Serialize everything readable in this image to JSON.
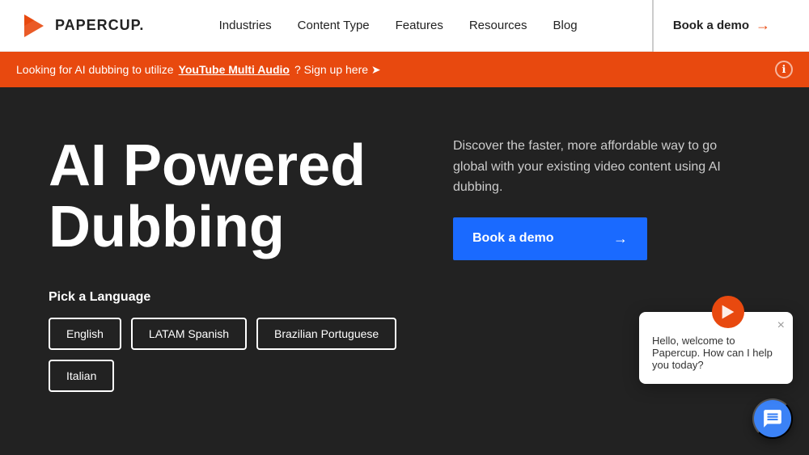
{
  "nav": {
    "logo_text": "PAPERCUP.",
    "links": [
      {
        "label": "Industries",
        "id": "industries"
      },
      {
        "label": "Content Type",
        "id": "content-type"
      },
      {
        "label": "Features",
        "id": "features"
      },
      {
        "label": "Resources",
        "id": "resources"
      },
      {
        "label": "Blog",
        "id": "blog"
      }
    ],
    "cta_label": "Book a demo"
  },
  "banner": {
    "prefix": "Looking for AI dubbing to utilize",
    "link": "YouTube Multi Audio",
    "suffix": "? Sign up here ➤",
    "info_icon": "ℹ"
  },
  "hero": {
    "title_line1": "AI Powered",
    "title_line2": "Dubbing",
    "description": "Discover the faster, more affordable way to go global with your existing video content using AI dubbing.",
    "cta_label": "Book a demo",
    "lang_label": "Pick a Language",
    "languages": [
      {
        "label": "English",
        "id": "english"
      },
      {
        "label": "LATAM Spanish",
        "id": "latam-spanish"
      },
      {
        "label": "Brazilian Portuguese",
        "id": "brazilian-portuguese"
      },
      {
        "label": "Italian",
        "id": "italian"
      }
    ]
  },
  "chat": {
    "greeting": "Hello, welcome to Papercup. How can I help you today?",
    "close_icon": "×"
  },
  "colors": {
    "orange": "#e8490f",
    "blue": "#1a6aff",
    "chat_blue": "#3b82f6",
    "dark_bg": "#222222",
    "nav_bg": "#ffffff"
  }
}
